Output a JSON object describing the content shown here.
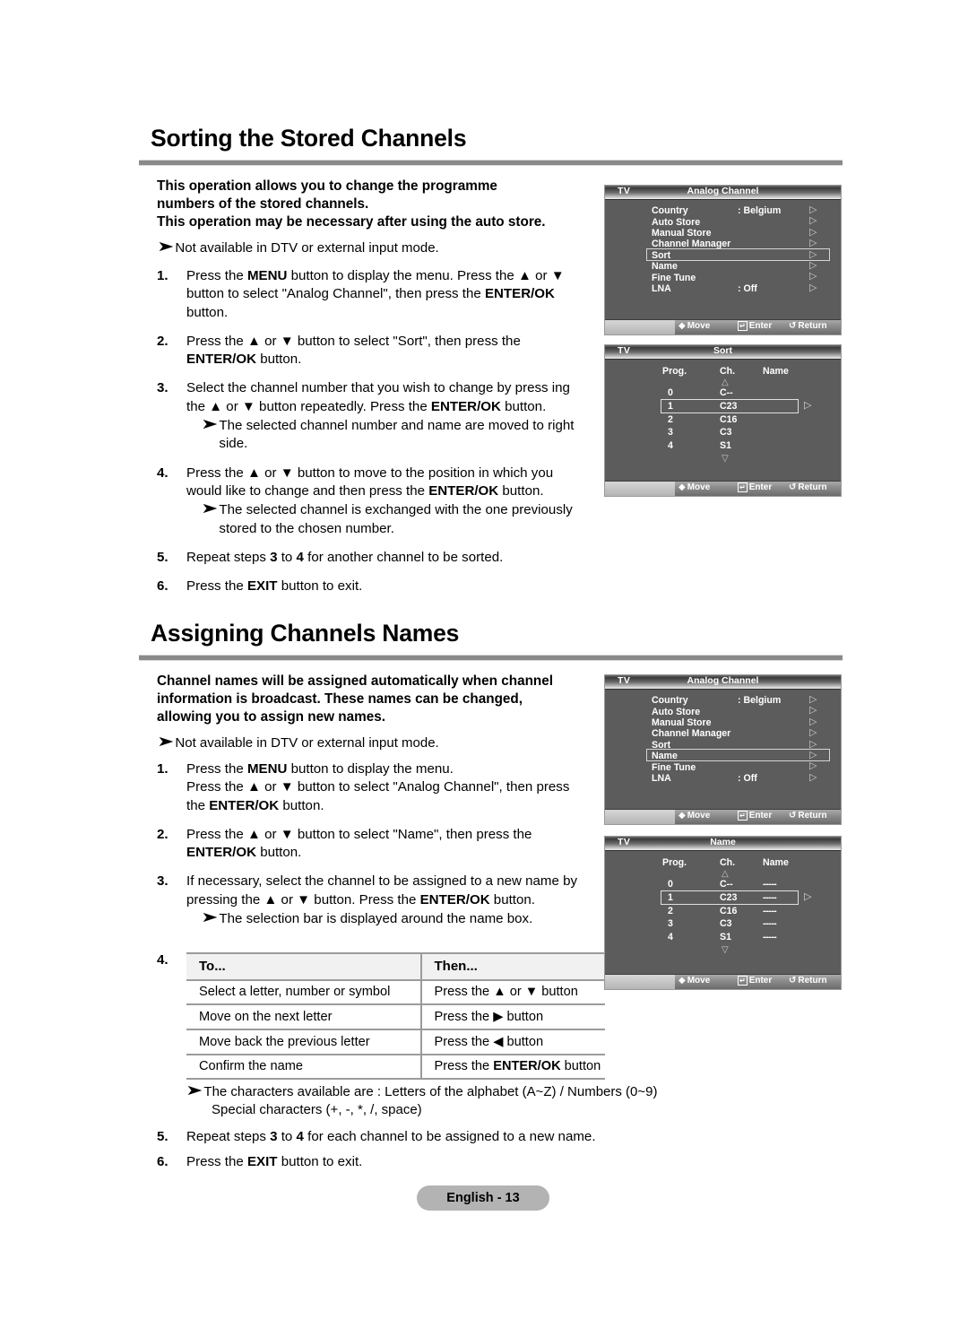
{
  "page": {
    "footer_label": "English - 13"
  },
  "section1": {
    "title": "Sorting the Stored Channels",
    "intro_lines": [
      "This operation allows you to change the programme",
      "numbers of the stored channels.",
      "This operation may be necessary after using the auto store."
    ],
    "note": "Not available in DTV or external input mode.",
    "steps": [
      {
        "num": "1.",
        "parts": [
          {
            "t": "Press the ",
            "b": false
          },
          {
            "t": "MENU",
            "b": true
          },
          {
            "t": " button to display the menu.  Press the ▲ or ▼ button to select \"Analog Channel\", then press the ",
            "b": false
          },
          {
            "t": "ENTER/OK",
            "b": true
          },
          {
            "t": " button.",
            "b": false
          }
        ]
      },
      {
        "num": "2.",
        "parts": [
          {
            "t": "Press the ▲ or ▼ button to select \"Sort\", then press the ",
            "b": false
          },
          {
            "t": "ENTER/OK",
            "b": true
          },
          {
            "t": " button.",
            "b": false
          }
        ]
      },
      {
        "num": "3.",
        "parts": [
          {
            "t": "Select the channel number that you wish to change by press ing the ▲ or ▼ button repeatedly. Press the ",
            "b": false
          },
          {
            "t": "ENTER/OK",
            "b": true
          },
          {
            "t": " button.",
            "b": false
          }
        ],
        "sub": "The selected channel number and name are moved to right side."
      },
      {
        "num": "4.",
        "parts": [
          {
            "t": "Press the ▲ or ▼ button to move to the position in which you would like to change and then press the  ",
            "b": false
          },
          {
            "t": "ENTER/OK",
            "b": true
          },
          {
            "t": " button.",
            "b": false
          }
        ],
        "sub": "The selected channel is exchanged with the one previously stored to the chosen number."
      },
      {
        "num": "5.",
        "parts": [
          {
            "t": "Repeat steps ",
            "b": false
          },
          {
            "t": "3",
            "b": true
          },
          {
            "t": " to ",
            "b": false
          },
          {
            "t": "4",
            "b": true
          },
          {
            "t": " for another channel to be sorted.",
            "b": false
          }
        ]
      },
      {
        "num": "6.",
        "parts": [
          {
            "t": "Press the ",
            "b": false
          },
          {
            "t": "EXIT",
            "b": true
          },
          {
            "t": " button to exit.",
            "b": false
          }
        ]
      }
    ]
  },
  "section2": {
    "title": "Assigning Channels Names",
    "intro_lines": [
      "Channel names will be assigned automatically when channel",
      "information is broadcast. These names can be changed,",
      "allowing you to assign new names."
    ],
    "note": "Not available in DTV or external input mode.",
    "steps": [
      {
        "num": "1.",
        "parts": [
          {
            "t": "Press the ",
            "b": false
          },
          {
            "t": "MENU",
            "b": true
          },
          {
            "t": " button to display the menu.",
            "b": false
          },
          {
            "t": "\n",
            "b": false
          },
          {
            "t": "Press the ▲ or ▼ button to select \"Analog Channel\", then press the ",
            "b": false
          },
          {
            "t": "ENTER/OK",
            "b": true
          },
          {
            "t": " button.",
            "b": false
          }
        ]
      },
      {
        "num": "2.",
        "parts": [
          {
            "t": "Press the ▲ or ▼ button to select \"Name\", then press the ",
            "b": false
          },
          {
            "t": "ENTER/OK",
            "b": true
          },
          {
            "t": " button.",
            "b": false
          }
        ]
      },
      {
        "num": "3.",
        "parts": [
          {
            "t": "If necessary, select the channel to be assigned to a new name by pressing the ▲ or ▼ button. Press the ",
            "b": false
          },
          {
            "t": "ENTER/OK",
            "b": true
          },
          {
            "t": " button.",
            "b": false
          }
        ],
        "sub": "The selection bar is displayed around the name box."
      }
    ],
    "step4_num": "4.",
    "table": {
      "headers": [
        "To...",
        "Then..."
      ],
      "rows": [
        {
          "to": "Select a letter, number or symbol",
          "then_parts": [
            {
              "t": "Press the ▲ or ▼ button",
              "b": false
            }
          ]
        },
        {
          "to": "Move on the next letter",
          "then_parts": [
            {
              "t": "Press the ▶ button",
              "b": false
            }
          ]
        },
        {
          "to": "Move back the previous letter",
          "then_parts": [
            {
              "t": "Press the ◀ button",
              "b": false
            }
          ]
        },
        {
          "to": "Confirm the name",
          "then_parts": [
            {
              "t": "Press the ",
              "b": false
            },
            {
              "t": "ENTER/OK",
              "b": true
            },
            {
              "t": " button",
              "b": false
            }
          ]
        }
      ]
    },
    "note2_line1": "The characters available are : Letters of the alphabet (A~Z) / Numbers (0~9)",
    "note2_line2": "Special characters (+, -, *, /, space)",
    "steps_tail": [
      {
        "num": "5.",
        "parts": [
          {
            "t": "Repeat steps ",
            "b": false
          },
          {
            "t": "3",
            "b": true
          },
          {
            "t": " to ",
            "b": false
          },
          {
            "t": "4",
            "b": true
          },
          {
            "t": " for each channel to be assigned to a new name.",
            "b": false
          }
        ]
      },
      {
        "num": "6.",
        "parts": [
          {
            "t": "Press the ",
            "b": false
          },
          {
            "t": "EXIT",
            "b": true
          },
          {
            "t": " button to exit.",
            "b": false
          }
        ]
      }
    ]
  },
  "osd": {
    "tv_label": "TV",
    "footer": {
      "move": "Move",
      "enter": "Enter",
      "return": "Return"
    },
    "analog_channel_1": {
      "title": "Analog Channel",
      "items": [
        {
          "label": "Country",
          "value": ": Belgium"
        },
        {
          "label": "Auto Store",
          "value": ""
        },
        {
          "label": "Manual Store",
          "value": ""
        },
        {
          "label": "Channel Manager",
          "value": ""
        },
        {
          "label": "Sort",
          "value": ""
        },
        {
          "label": "Name",
          "value": ""
        },
        {
          "label": "Fine Tune",
          "value": ""
        },
        {
          "label": "LNA",
          "value": ": Off"
        }
      ],
      "selected_index": 4
    },
    "analog_channel_2": {
      "title": "Analog Channel",
      "items": [
        {
          "label": "Country",
          "value": ": Belgium"
        },
        {
          "label": "Auto Store",
          "value": ""
        },
        {
          "label": "Manual Store",
          "value": ""
        },
        {
          "label": "Channel Manager",
          "value": ""
        },
        {
          "label": "Sort",
          "value": ""
        },
        {
          "label": "Name",
          "value": ""
        },
        {
          "label": "Fine Tune",
          "value": ""
        },
        {
          "label": "LNA",
          "value": ": Off"
        }
      ],
      "selected_index": 5
    },
    "sort": {
      "title": "Sort",
      "columns": [
        "Prog.",
        "Ch.",
        "Name"
      ],
      "rows": [
        {
          "prog": "0",
          "ch": "C--",
          "name": ""
        },
        {
          "prog": "1",
          "ch": "C23",
          "name": ""
        },
        {
          "prog": "2",
          "ch": "C16",
          "name": ""
        },
        {
          "prog": "3",
          "ch": "C3",
          "name": ""
        },
        {
          "prog": "4",
          "ch": "S1",
          "name": ""
        }
      ],
      "selected_index": 1
    },
    "name": {
      "title": "Name",
      "columns": [
        "Prog.",
        "Ch.",
        "Name"
      ],
      "rows": [
        {
          "prog": "0",
          "ch": "C--",
          "name": "-----"
        },
        {
          "prog": "1",
          "ch": "C23",
          "name": "-----"
        },
        {
          "prog": "2",
          "ch": "C16",
          "name": "-----"
        },
        {
          "prog": "3",
          "ch": "C3",
          "name": "-----"
        },
        {
          "prog": "4",
          "ch": "S1",
          "name": "-----"
        }
      ],
      "selected_index": 1
    }
  }
}
